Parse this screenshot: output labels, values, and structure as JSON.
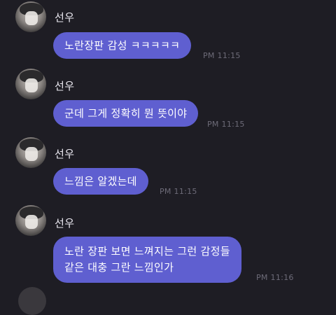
{
  "messages": [
    {
      "sender": "선우",
      "text": "노란장판 감성 ㅋㅋㅋㅋㅋ",
      "time": "PM 11:15"
    },
    {
      "sender": "선우",
      "text": "군데 그게 정확히 뭔 뜻이야",
      "time": "PM 11:15"
    },
    {
      "sender": "선우",
      "text": "느낌은 알겠는데",
      "time": "PM 11:15"
    },
    {
      "sender": "선우",
      "lines": [
        "노란 장판 보면 느껴지는 그런 감정들",
        "같은 대충 그란 느낌인가"
      ],
      "time": "PM 11:16"
    }
  ]
}
